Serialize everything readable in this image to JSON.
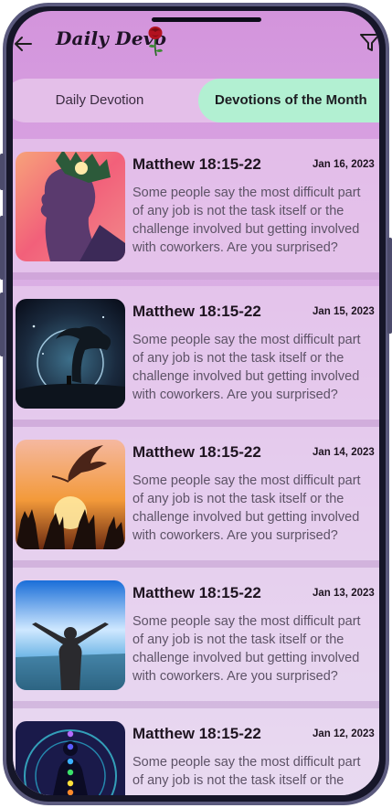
{
  "header": {
    "title": "Daily Devo",
    "back_icon": "arrow-left-icon",
    "rose_icon": "rose-icon",
    "filter_icon": "filter-icon"
  },
  "tabs": [
    {
      "label": "Daily Devotion",
      "active": false
    },
    {
      "label": "Devotions of the Month",
      "active": true
    }
  ],
  "colors": {
    "active_tab": "#b2f0d2",
    "header_bg": "#d394dc",
    "tab_bar": "#e4bfe9"
  },
  "devotions": [
    {
      "reference": "Matthew 18:15-22",
      "date": "Jan 16, 2023",
      "excerpt_lines": [
        "Some people say the most difficult part",
        "of any job is not the task itself or the",
        "challenge involved but getting involved",
        "with coworkers. Are you surprised?"
      ],
      "image": "woman-profile-forest"
    },
    {
      "reference": "Matthew 18:15-22",
      "date": "Jan 15, 2023",
      "excerpt_lines": [
        "Some people say the most difficult part",
        "of any job is not the task itself or the",
        "challenge involved but getting involved",
        "with coworkers. Are you surprised?"
      ],
      "image": "meditation-tree-night"
    },
    {
      "reference": "Matthew 18:15-22",
      "date": "Jan 14, 2023",
      "excerpt_lines": [
        "Some people say the most difficult part",
        "of any job is not the task itself or the",
        "challenge involved but getting involved",
        "with coworkers. Are you surprised?"
      ],
      "image": "dove-raised-hands"
    },
    {
      "reference": "Matthew 18:15-22",
      "date": "Jan 13, 2023",
      "excerpt_lines": [
        "Some people say the most difficult part",
        "of any job is not the task itself or the",
        "challenge involved but getting involved",
        "with coworkers. Are you surprised?"
      ],
      "image": "woman-arms-raised-sky"
    },
    {
      "reference": "Matthew 18:15-22",
      "date": "Jan 12, 2023",
      "excerpt_lines": [
        "Some people say the most difficult part",
        "of any job is not the task itself or the"
      ],
      "image": "chakra-meditation"
    }
  ]
}
